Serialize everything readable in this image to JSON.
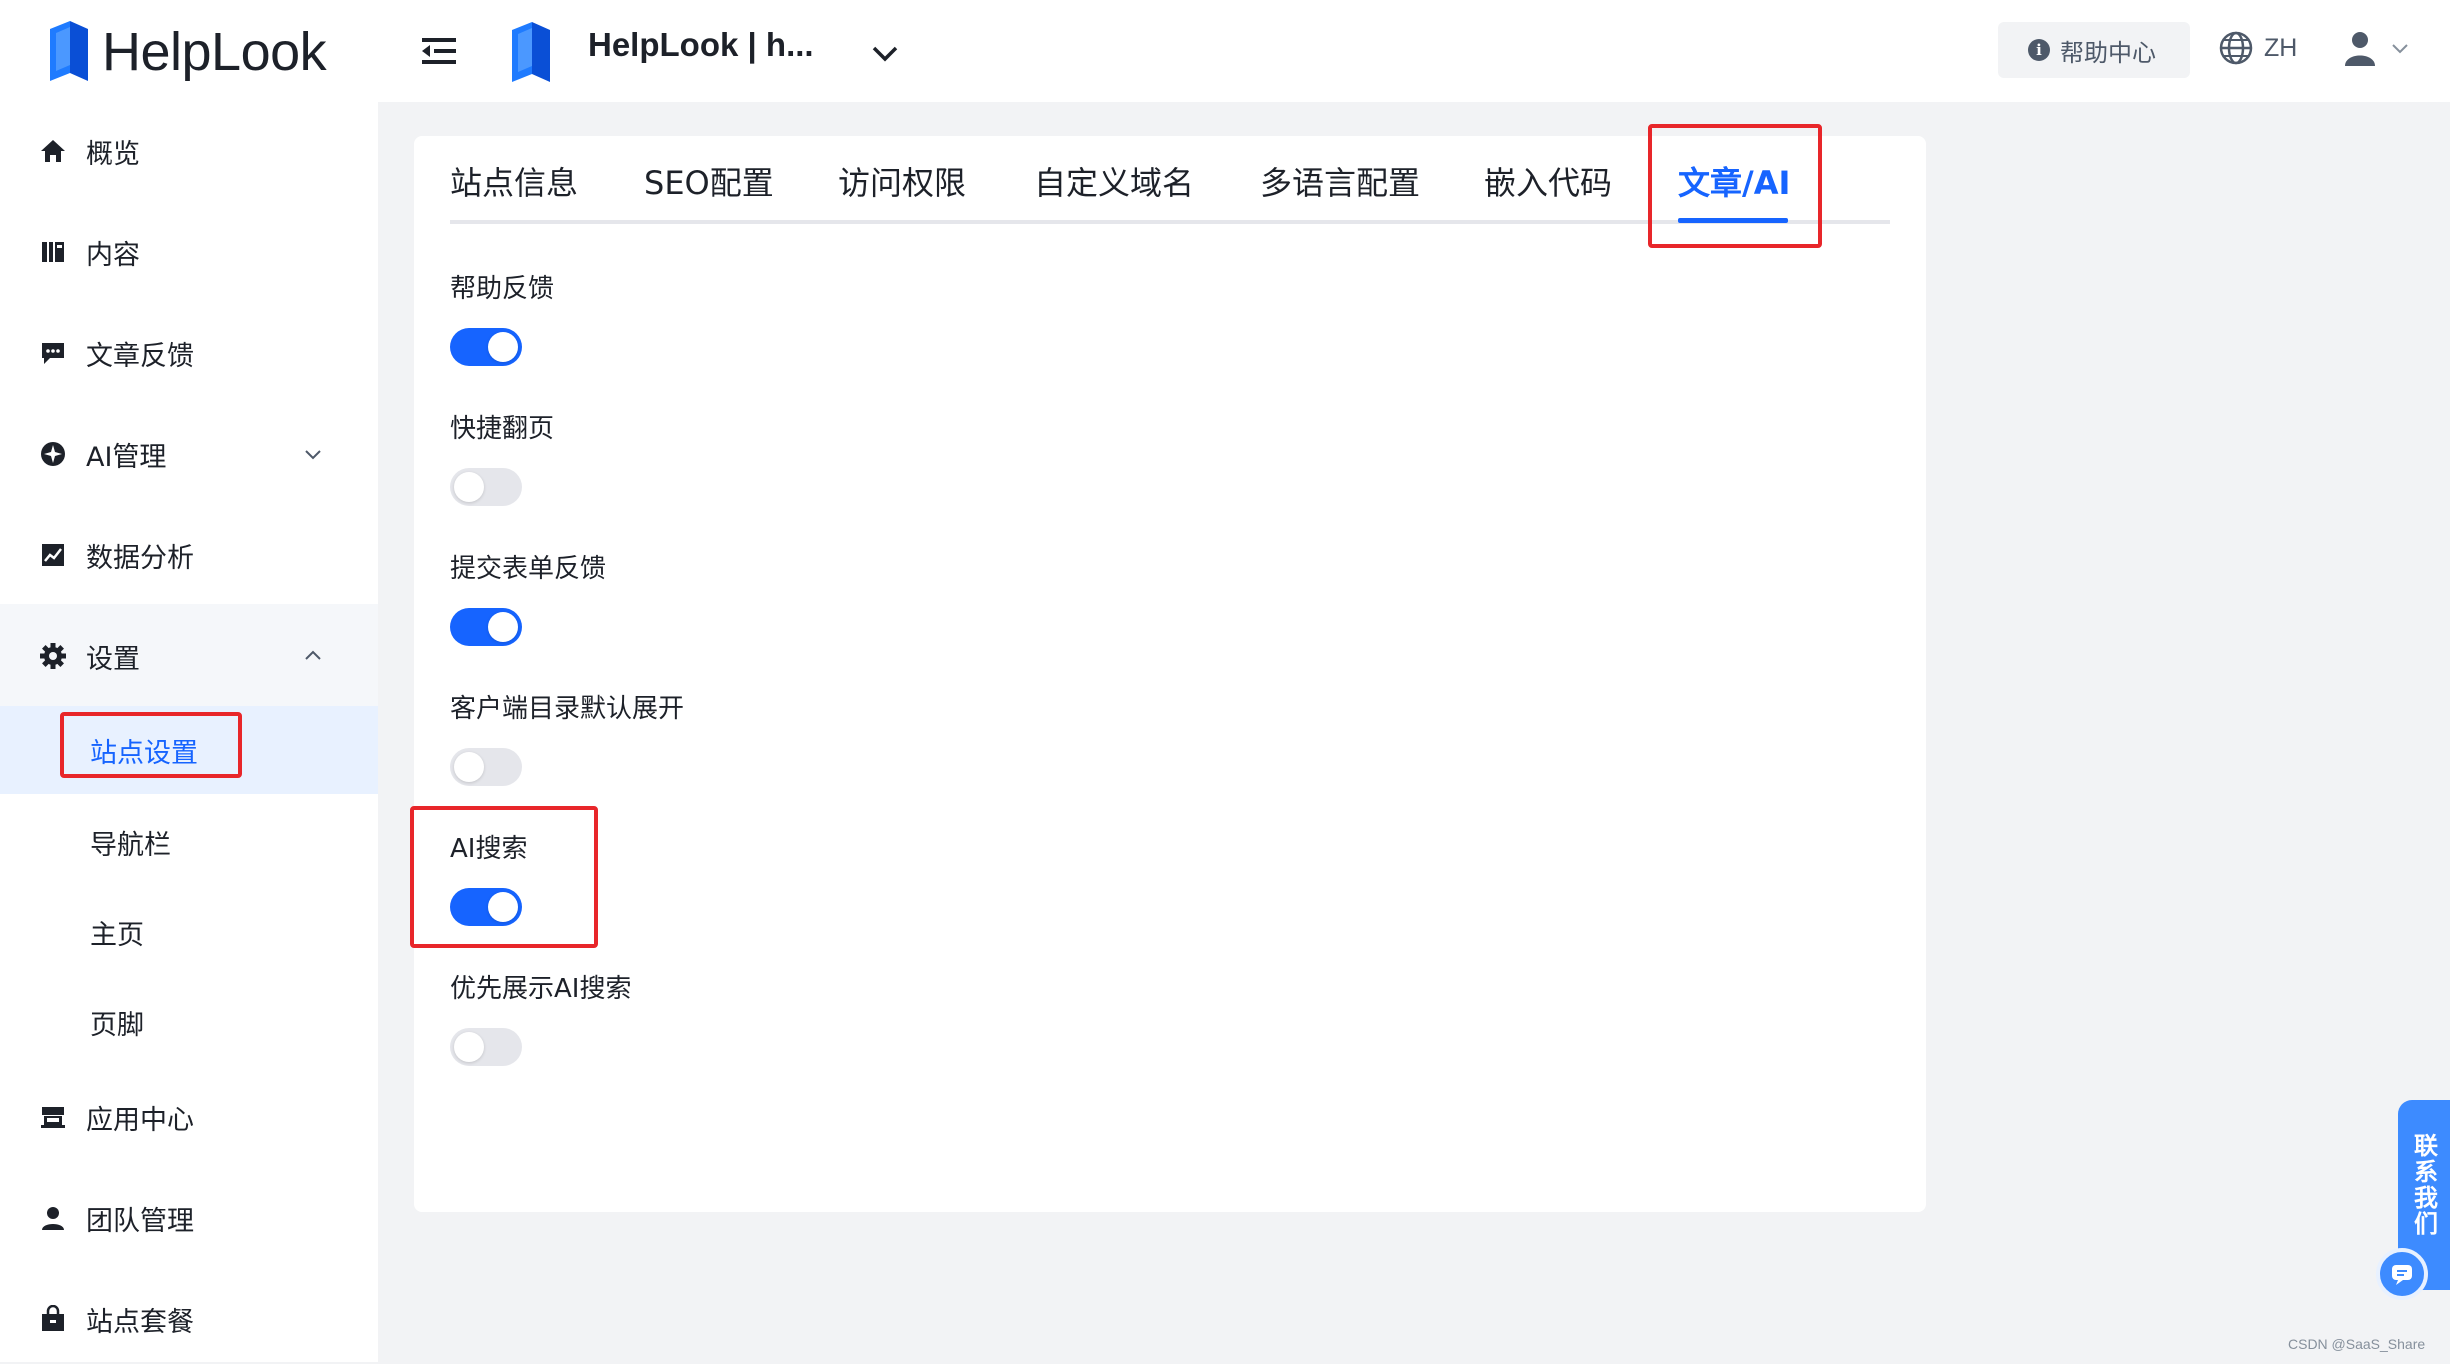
{
  "brand": {
    "name": "HelpLook",
    "accent": "#1664ff"
  },
  "sidebar": {
    "items": [
      {
        "label": "概览",
        "icon": "home-icon"
      },
      {
        "label": "内容",
        "icon": "book-icon"
      },
      {
        "label": "文章反馈",
        "icon": "comment-icon"
      },
      {
        "label": "AI管理",
        "icon": "ai-icon"
      },
      {
        "label": "数据分析",
        "icon": "chart-icon"
      },
      {
        "label": "设置",
        "icon": "gear-icon"
      },
      {
        "label": "应用中心",
        "icon": "store-icon"
      },
      {
        "label": "团队管理",
        "icon": "user-icon"
      },
      {
        "label": "站点套餐",
        "icon": "bag-icon"
      }
    ],
    "settings_sub": [
      {
        "label": "站点设置",
        "active": true
      },
      {
        "label": "导航栏",
        "active": false
      },
      {
        "label": "主页",
        "active": false
      },
      {
        "label": "页脚",
        "active": false
      }
    ]
  },
  "header": {
    "site_title": "HelpLook | h...",
    "help_label": "帮助中心",
    "lang_label": "ZH"
  },
  "tabs": [
    {
      "label": "站点信息",
      "active": false
    },
    {
      "label": "SEO配置",
      "active": false
    },
    {
      "label": "访问权限",
      "active": false
    },
    {
      "label": "自定义域名",
      "active": false
    },
    {
      "label": "多语言配置",
      "active": false
    },
    {
      "label": "嵌入代码",
      "active": false
    },
    {
      "label": "文章/AI",
      "active": true
    }
  ],
  "settings": [
    {
      "label": "帮助反馈",
      "enabled": true
    },
    {
      "label": "快捷翻页",
      "enabled": false
    },
    {
      "label": "提交表单反馈",
      "enabled": true
    },
    {
      "label": "客户端目录默认展开",
      "enabled": false
    },
    {
      "label": "AI搜索",
      "enabled": true
    },
    {
      "label": "优先展示AI搜索",
      "enabled": false
    }
  ],
  "floating": {
    "contact_label": "联系我们"
  },
  "watermark": "CSDN @SaaS_Share"
}
